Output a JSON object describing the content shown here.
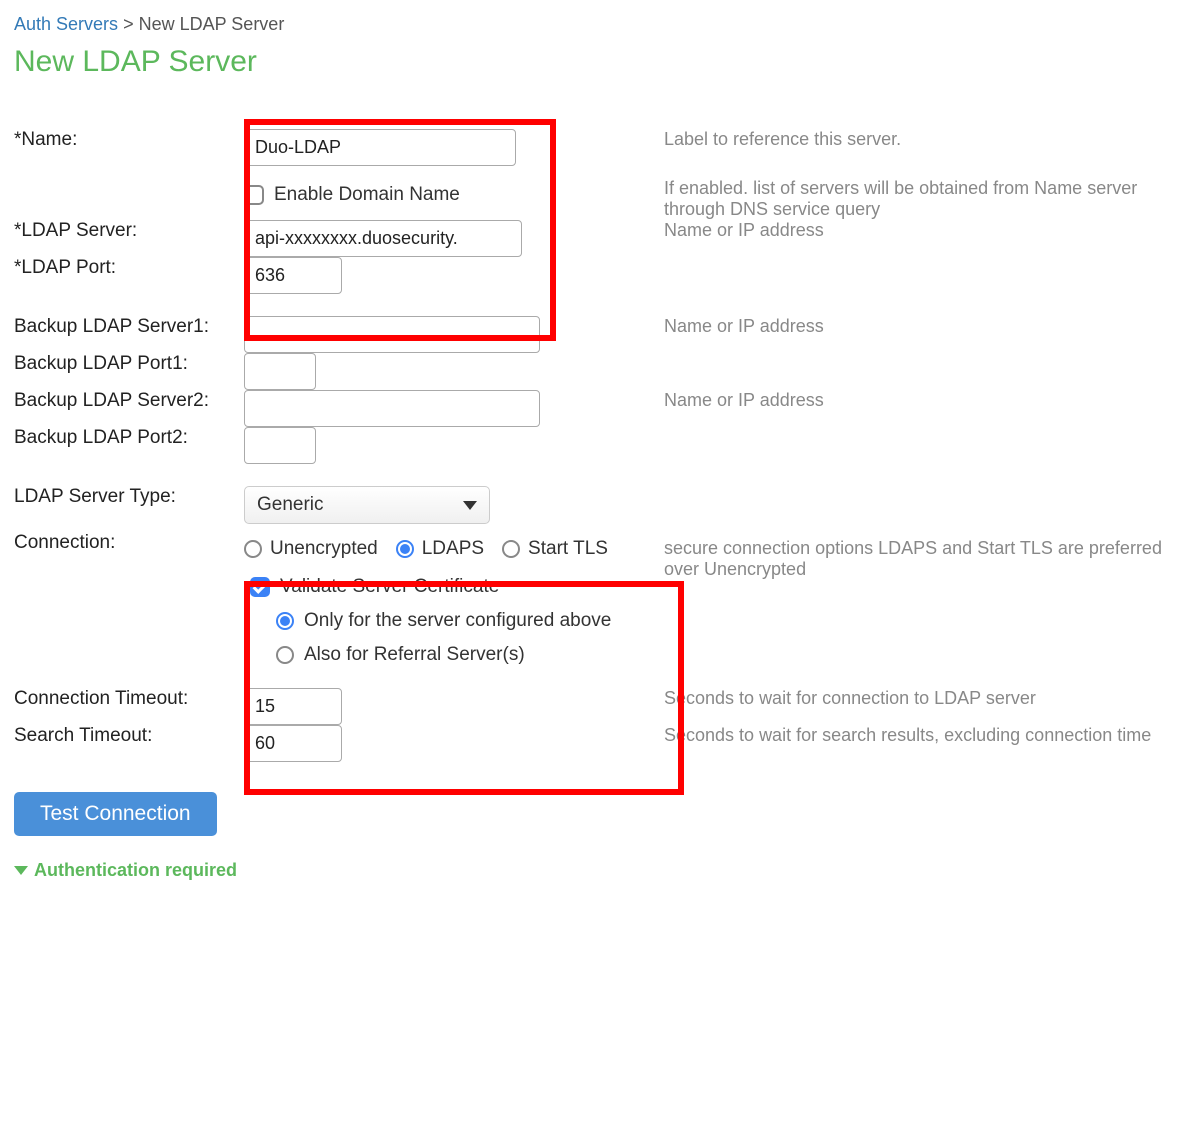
{
  "breadcrumb": {
    "parent": "Auth Servers",
    "separator": ">",
    "current": "New LDAP Server"
  },
  "page_title": "New LDAP Server",
  "fields": {
    "name": {
      "label": "*Name:",
      "value": "Duo-LDAP",
      "hint": "Label to reference this server."
    },
    "enable_domain": {
      "label": "Enable Domain Name",
      "checked": false,
      "hint": "If enabled. list of servers will be obtained from Name server through DNS service query"
    },
    "ldap_server": {
      "label": "*LDAP Server:",
      "value": "api-xxxxxxxx.duosecurity.",
      "hint": "Name or IP address"
    },
    "ldap_port": {
      "label": "*LDAP Port:",
      "value": "636"
    },
    "backup_server1": {
      "label": "Backup LDAP Server1:",
      "value": "",
      "hint": "Name or IP address"
    },
    "backup_port1": {
      "label": "Backup LDAP Port1:",
      "value": ""
    },
    "backup_server2": {
      "label": "Backup LDAP Server2:",
      "value": "",
      "hint": "Name or IP address"
    },
    "backup_port2": {
      "label": "Backup LDAP Port2:",
      "value": ""
    },
    "server_type": {
      "label": "LDAP Server Type:",
      "value": "Generic"
    },
    "connection": {
      "label": "Connection:",
      "options": {
        "unencrypted": "Unencrypted",
        "ldaps": "LDAPS",
        "starttls": "Start TLS"
      },
      "selected": "ldaps",
      "hint": "secure connection options LDAPS and Start TLS are preferred over Unencrypted"
    },
    "validate_cert": {
      "label": "Validate Server Certificate",
      "checked": true,
      "scope_options": {
        "only": "Only for the server configured above",
        "also": "Also for Referral Server(s)"
      },
      "scope_selected": "only"
    },
    "conn_timeout": {
      "label": "Connection Timeout:",
      "value": "15",
      "hint": "Seconds to wait for connection to LDAP server"
    },
    "search_timeout": {
      "label": "Search Timeout:",
      "value": "60",
      "hint": "Seconds to wait for search results, excluding connection time"
    }
  },
  "buttons": {
    "test_connection": "Test Connection"
  },
  "sections": {
    "auth_required": "Authentication required"
  }
}
